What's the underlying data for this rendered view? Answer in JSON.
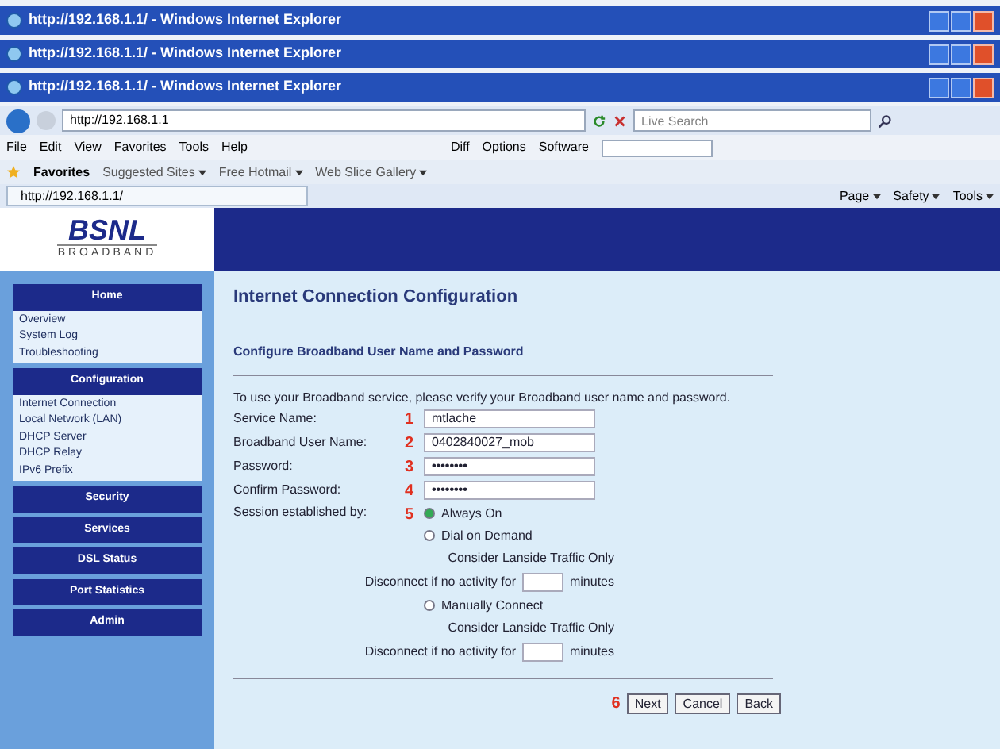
{
  "windows": [
    {
      "title": "http://192.168.1.1/ - Windows Internet Explorer"
    },
    {
      "title": "http://192.168.1.1/ - Windows Internet Explorer"
    },
    {
      "title": "http://192.168.1.1/ - Windows Internet Explorer"
    }
  ],
  "address": "http://192.168.1.1",
  "search": {
    "placeholder": "Live Search"
  },
  "menu": [
    "File",
    "Edit",
    "View",
    "Favorites",
    "Tools",
    "Help"
  ],
  "toolbar": [
    "Diff",
    "Options",
    "Software"
  ],
  "favorites": {
    "label": "Favorites",
    "links": [
      "Suggested Sites",
      "Free Hotmail",
      "Web Slice Gallery"
    ]
  },
  "tab": "http://192.168.1.1/",
  "command_bar": [
    "Page",
    "Safety",
    "Tools"
  ],
  "logo": {
    "name": "BSNL",
    "tagline": "BROADBAND"
  },
  "sidebar": [
    {
      "label": "Home",
      "children": [
        {
          "label": "Overview"
        },
        {
          "label": "System Log"
        },
        {
          "label": "Troubleshooting"
        }
      ]
    },
    {
      "label": "Configuration",
      "children": [
        {
          "label": "Internet Connection"
        },
        {
          "label": "Local Network (LAN)"
        },
        {
          "label": "DHCP Server"
        },
        {
          "label": "DHCP Relay"
        },
        {
          "label": "IPv6 Prefix"
        }
      ]
    },
    {
      "label": "Security"
    },
    {
      "label": "Services"
    },
    {
      "label": "DSL Status"
    },
    {
      "label": "Port Statistics"
    },
    {
      "label": "Admin"
    }
  ],
  "page_title": "Internet Connection Configuration",
  "section_title": "Configure Broadband User Name and Password",
  "intro": "To use your Broadband service, please verify your Broadband user name and password.",
  "fields": [
    {
      "step": "1",
      "label": "Service Name:",
      "value": "mtlache"
    },
    {
      "step": "2",
      "label": "Broadband User Name:",
      "value": "0402840027_mob"
    },
    {
      "step": "3",
      "label": "Password:",
      "value": "••••••••"
    },
    {
      "step": "4",
      "label": "Confirm Password:",
      "value": "••••••••"
    }
  ],
  "session": {
    "step": "5",
    "label": "Session established by:",
    "options": [
      {
        "label": "Always On",
        "selected": true
      },
      {
        "label": "Dial on Demand",
        "selected": false,
        "lanside": "Consider Lanside Traffic Only",
        "disconnect": "Disconnect if no activity for",
        "unit": "minutes"
      },
      {
        "label": "Manually Connect",
        "selected": false,
        "lanside": "Consider Lanside Traffic Only",
        "disconnect": "Disconnect if no activity for",
        "unit": "minutes"
      }
    ]
  },
  "buttons_step": "6",
  "buttons": [
    "Next",
    "Cancel",
    "Back"
  ]
}
